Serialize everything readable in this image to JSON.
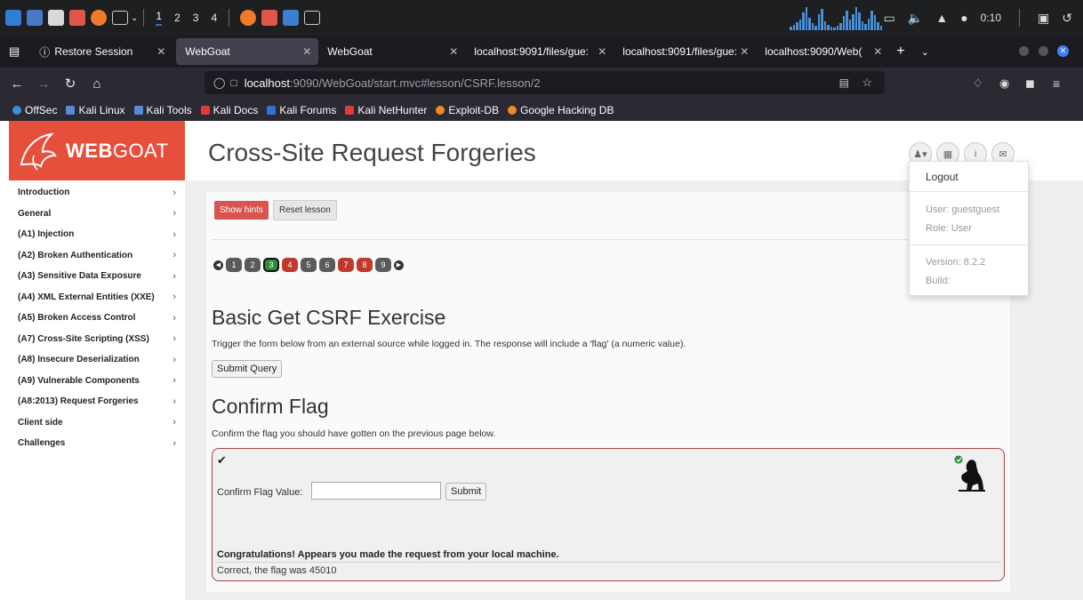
{
  "taskbar": {
    "workspaces": [
      "1",
      "2",
      "3",
      "4"
    ],
    "active_workspace": "1",
    "clock": "0:10",
    "graph_levels": [
      4,
      6,
      9,
      12,
      20,
      26,
      14,
      8,
      5,
      18,
      24,
      10,
      6,
      4,
      3,
      5,
      8,
      16,
      22,
      12,
      18,
      26,
      20,
      10,
      7,
      13,
      22,
      17,
      9,
      5
    ]
  },
  "tabs": [
    {
      "label": "Restore Session",
      "active": false
    },
    {
      "label": "WebGoat",
      "active": true
    },
    {
      "label": "WebGoat",
      "active": false
    },
    {
      "label": "localhost:9091/files/gue:",
      "active": false
    },
    {
      "label": "localhost:9091/files/gue:",
      "active": false
    },
    {
      "label": "localhost:9090/Web(",
      "active": false
    }
  ],
  "nav": {
    "url_host": "localhost",
    "url_rest": ":9090/WebGoat/start.mvc#lesson/CSRF.lesson/2"
  },
  "bookmarks": [
    {
      "label": "OffSec",
      "color": "#3b8fd8"
    },
    {
      "label": "Kali Linux",
      "color": "#5a8ad6"
    },
    {
      "label": "Kali Tools",
      "color": "#5a8ad6"
    },
    {
      "label": "Kali Docs",
      "color": "#e03b3b"
    },
    {
      "label": "Kali Forums",
      "color": "#3b6fd8"
    },
    {
      "label": "Kali NetHunter",
      "color": "#e03b3b"
    },
    {
      "label": "Exploit-DB",
      "color": "#f08a24"
    },
    {
      "label": "Google Hacking DB",
      "color": "#f08a24"
    }
  ],
  "logo": {
    "bold": "WEB",
    "rest": "GOAT"
  },
  "sidebar": {
    "items": [
      "Introduction",
      "General",
      "(A1) Injection",
      "(A2) Broken Authentication",
      "(A3) Sensitive Data Exposure",
      "(A4) XML External Entities (XXE)",
      "(A5) Broken Access Control",
      "(A7) Cross-Site Scripting (XSS)",
      "(A8) Insecure Deserialization",
      "(A9) Vulnerable Components",
      "(A8:2013) Request Forgeries",
      "Client side",
      "Challenges"
    ]
  },
  "header": {
    "title": "Cross-Site Request Forgeries"
  },
  "user_menu": {
    "logout": "Logout",
    "user": "User: guestguest",
    "role": "Role: User",
    "version": "Version: 8.2.2",
    "build": "Build:"
  },
  "lesson": {
    "show_hints": "Show hints",
    "reset_lesson": "Reset lesson",
    "steps": [
      {
        "n": "1",
        "state": "grey"
      },
      {
        "n": "2",
        "state": "grey"
      },
      {
        "n": "3",
        "state": "current"
      },
      {
        "n": "4",
        "state": "red"
      },
      {
        "n": "5",
        "state": "grey"
      },
      {
        "n": "6",
        "state": "grey"
      },
      {
        "n": "7",
        "state": "red"
      },
      {
        "n": "8",
        "state": "red"
      },
      {
        "n": "9",
        "state": "grey"
      }
    ],
    "step_colors": {
      "grey": "#5a5a5a",
      "red": "#c0392b",
      "current": "#2e8b3a"
    },
    "section1_title": "Basic Get CSRF Exercise",
    "section1_text": "Trigger the form below from an external source while logged in. The response will include a 'flag' (a numeric value).",
    "submit_query": "Submit Query",
    "section2_title": "Confirm Flag",
    "section2_text": "Confirm the flag you should have gotten on the previous page below.",
    "confirm_label": "Confirm Flag Value:",
    "confirm_value": "",
    "submit": "Submit",
    "success_message": "Congratulations! Appears you made the request from your local machine.",
    "result_message": "Correct, the flag was 45010"
  }
}
